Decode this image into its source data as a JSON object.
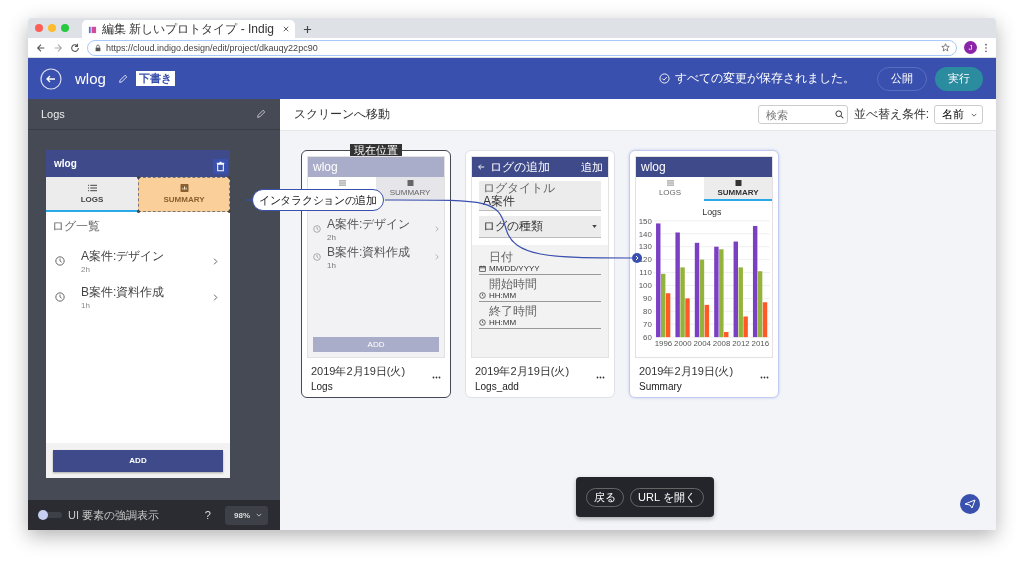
{
  "browser": {
    "tab_title": "編集 新しいプロトタイプ - Indig",
    "url": "https://cloud.indigo.design/edit/project/dkauqy22pc90",
    "avatar": "J"
  },
  "header": {
    "project": "wlog",
    "badge": "下書き",
    "status": "すべての変更が保存されました。",
    "buttons": [
      {
        "label": "公開",
        "kind": "outline"
      },
      {
        "label": "実行",
        "kind": "primary"
      }
    ]
  },
  "sidebar": {
    "title": "Logs",
    "preview": {
      "title": "wlog",
      "tabs": [
        {
          "label": "LOGS",
          "selected": true,
          "highlighted": false
        },
        {
          "label": "SUMMARY",
          "selected": false,
          "highlighted": true
        }
      ],
      "section": "ログ一覧",
      "items": [
        {
          "title": "A案件:デザイン",
          "sub": "2h"
        },
        {
          "title": "B案件:資料作成",
          "sub": "1h"
        }
      ],
      "button": "ADD"
    },
    "highlight_toggle": {
      "label": "UI 要素の強調表示",
      "on": false
    },
    "help": "?",
    "zoom": "98%"
  },
  "interaction": {
    "label": "インタラクションの追加"
  },
  "main": {
    "title": "スクリーンへ移動",
    "search": {
      "placeholder": "検索"
    },
    "sort": {
      "label": "並べ替え条件:",
      "value": "名前"
    },
    "screens": [
      {
        "kind": "logs",
        "date": "2019年2月19日(火)",
        "name": "Logs",
        "current": true,
        "badge": "現在位置",
        "selected": false,
        "screen": {
          "title": "wlog",
          "tabs": [
            {
              "selected": true
            },
            {
              "label": "SUMMARY",
              "selected": false
            }
          ],
          "items": [
            {
              "title": "A案件:デザイン",
              "sub": "2h"
            },
            {
              "title": "B案件:資料作成",
              "sub": "1h"
            }
          ],
          "button": "ADD"
        }
      },
      {
        "kind": "form",
        "date": "2019年2月19日(火)",
        "name": "Logs_add",
        "current": false,
        "selected": false,
        "screen": {
          "title": "ログの追加",
          "action": "追加",
          "fields": [
            {
              "kind": "text",
              "label": "ログタイトル",
              "value": "A案件"
            },
            {
              "kind": "select",
              "value": "ログの種類"
            },
            {
              "kind": "date",
              "label": "日付",
              "value": "MM/DD/YYYY"
            },
            {
              "kind": "time",
              "label": "開始時間",
              "value": "HH:MM"
            },
            {
              "kind": "time",
              "label": "終了時間",
              "value": "HH:MM"
            }
          ]
        }
      },
      {
        "kind": "chart",
        "date": "2019年2月19日(火)",
        "name": "Summary",
        "current": false,
        "selected": true,
        "screen": {
          "title": "wlog",
          "tabs": [
            {
              "label": "LOGS",
              "selected": false
            },
            {
              "label": "SUMMARY",
              "selected": true
            }
          ],
          "chart_data": {
            "type": "bar",
            "title": "Logs",
            "categories": [
              "1996",
              "2000",
              "2004",
              "2008",
              "2012",
              "2016"
            ],
            "series": [
              {
                "color": "#7b3fc4",
                "values": [
                  148,
                  141,
                  133,
                  130,
                  134,
                  146
                ]
              },
              {
                "color": "#93b33a",
                "values": [
                  109,
                  114,
                  120,
                  128,
                  114,
                  111
                ]
              },
              {
                "color": "#ff5a26",
                "values": [
                  94,
                  90,
                  85,
                  64,
                  76,
                  87
                ]
              }
            ],
            "ylim": [
              60,
              150
            ],
            "yticks": [
              60,
              70,
              80,
              90,
              100,
              110,
              120,
              130,
              140,
              150
            ],
            "grid": true
          }
        }
      }
    ]
  },
  "toolbar": {
    "buttons": [
      "戻る",
      "URL を開く"
    ]
  }
}
